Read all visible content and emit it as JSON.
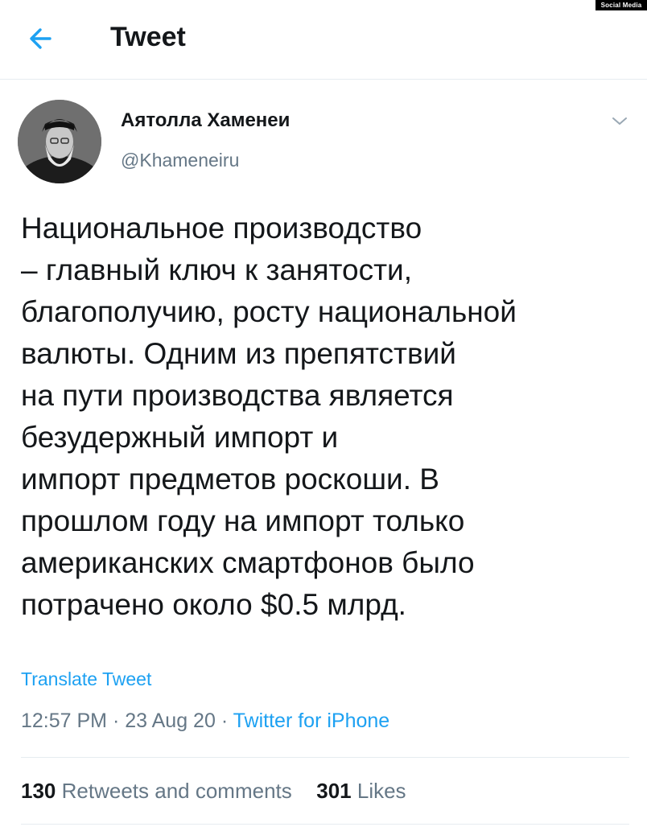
{
  "watermark": "Social Media",
  "header": {
    "title": "Tweet",
    "back_icon": "arrow-left-icon",
    "accent": "#1da1f2"
  },
  "author": {
    "display_name": "Аятолла Хаменеи",
    "handle": "@Khameneiru"
  },
  "tweet": {
    "lines": [
      "Национальное производство",
      "– главный ключ к занятости,",
      "благополучию, росту национальной",
      "валюты. Одним из препятствий",
      "на пути производства является",
      "безудержный импорт и",
      "импорт предметов роскоши. В",
      "прошлом году на импорт только",
      "американских смартфонов было",
      "потрачено около $0.5 млрд."
    ],
    "translate_label": "Translate Tweet",
    "time": "12:57 PM",
    "date": "23 Aug 20",
    "source": "Twitter for iPhone"
  },
  "stats": {
    "retweets_count": "130",
    "retweets_label": "Retweets and comments",
    "likes_count": "301",
    "likes_label": "Likes"
  }
}
